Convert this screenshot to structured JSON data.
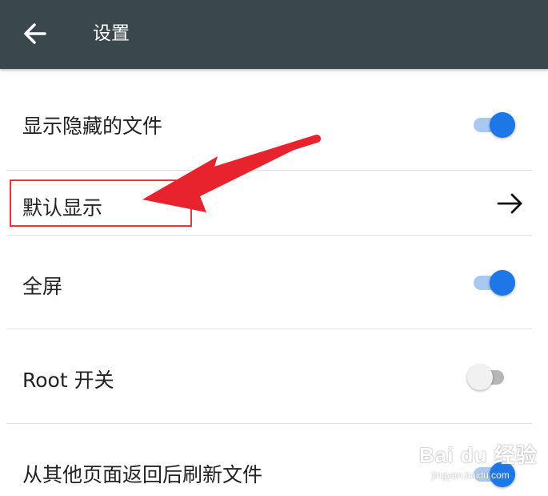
{
  "app_bar": {
    "title": "设置",
    "back_icon": "arrow-left-icon",
    "background_color": "#3a474d"
  },
  "settings": [
    {
      "label": "显示隐藏的文件",
      "control": "switch",
      "state": "on"
    },
    {
      "label": "默认显示",
      "control": "arrow",
      "icon": "arrow-right-icon"
    },
    {
      "label": "全屏",
      "control": "switch",
      "state": "on"
    },
    {
      "label": "Root 开关",
      "control": "switch",
      "state": "off"
    },
    {
      "label": "从其他页面返回后刷新文件",
      "control": "switch",
      "state": "on"
    }
  ],
  "colors": {
    "switch_on_thumb": "#1e77e6",
    "switch_on_track": "#a9c8f2",
    "switch_off_thumb": "#f1f1f1",
    "switch_off_track": "#b7b7b7",
    "annotation_red": "#e8232e"
  },
  "annotation": {
    "type": "red-arrow-pointing-to-highlighted-item",
    "highlighted_item": "默认显示"
  },
  "watermark": {
    "main": "Bai du 经验",
    "sub": "jingyan.baidu.com"
  }
}
